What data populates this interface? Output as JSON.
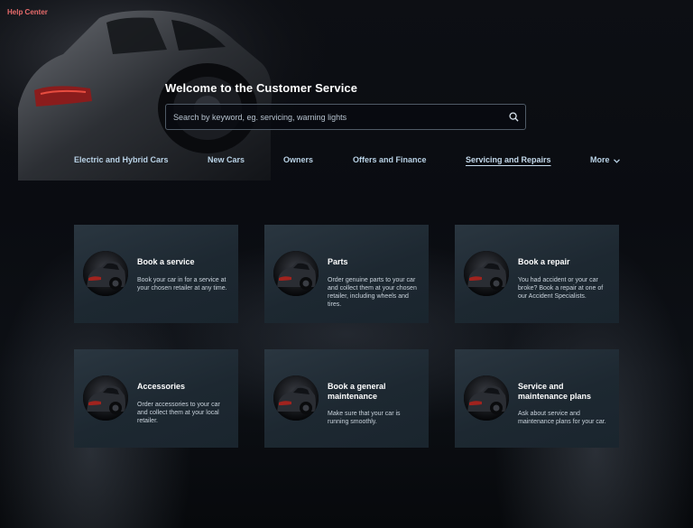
{
  "header": {
    "help_center": "Help Center",
    "headline": "Welcome to the Customer Service"
  },
  "search": {
    "placeholder": "Search by keyword, eg. servicing, warning lights",
    "value": ""
  },
  "nav": {
    "items": [
      {
        "label": "Electric and Hybrid Cars"
      },
      {
        "label": "New Cars"
      },
      {
        "label": "Owners"
      },
      {
        "label": "Offers and Finance"
      },
      {
        "label": "Servicing and Repairs",
        "active": true
      },
      {
        "label": "More"
      }
    ]
  },
  "cards": [
    {
      "title": "Book a service",
      "description": "Book your car in for a service at your chosen retailer at any time."
    },
    {
      "title": "Parts",
      "description": "Order genuine parts to your car and collect them at your chosen retailer, including wheels and tires."
    },
    {
      "title": "Book a repair",
      "description": "You had accident or your car broke? Book a repair at one of our Accident Specialists."
    },
    {
      "title": "Accessories",
      "description": "Order accessories to your car and collect them at your local retailer."
    },
    {
      "title": "Book a general maintenance",
      "description": "Make sure that your car is running smoothly."
    },
    {
      "title": "Service and maintenance plans",
      "description": "Ask about service and maintenance plans for your car."
    }
  ],
  "colors": {
    "accent": "#e86b6b",
    "nav_text": "#b9d2e6",
    "card_bg": "#1d2831"
  },
  "icons": [
    "search-icon",
    "chevron-down-icon"
  ]
}
